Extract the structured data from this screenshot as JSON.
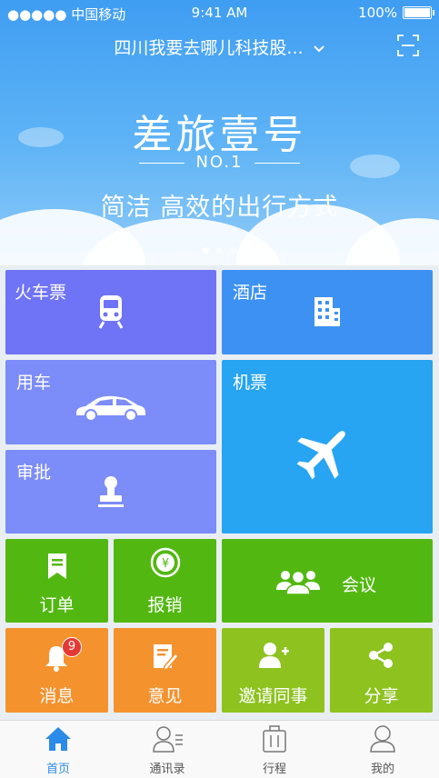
{
  "status_bar": {
    "carrier": "●●●●● 中国移动",
    "time": "9:41 AM",
    "battery": "100%"
  },
  "header": {
    "company": "四川我要去哪儿科技股...",
    "dropdown_icon": "chevron-down-icon",
    "scan_icon": "scan-icon"
  },
  "banner": {
    "title": "差旅壹号",
    "tagline": "NO.1",
    "subtitle": "简洁 高效的出行方式",
    "page_count": 3,
    "active_page": 1
  },
  "tiles": {
    "train": "火车票",
    "hotel": "酒店",
    "car": "用车",
    "flight": "机票",
    "approval": "审批",
    "order": "订单",
    "expense": "报销",
    "meeting": "会议",
    "message": "消息",
    "message_badge": "9",
    "feedback": "意见",
    "invite": "邀请同事",
    "share": "分享"
  },
  "colors": {
    "blue_dark": "#6f73f5",
    "blue": "#3d91f3",
    "sky": "#27a4f2",
    "purple": "#7c8cf8",
    "green": "#52b811",
    "orange": "#f4922e",
    "lime": "#8dc21f"
  },
  "tabbar": [
    {
      "label": "首页",
      "icon": "home-icon",
      "active": true
    },
    {
      "label": "通讯录",
      "icon": "contacts-icon",
      "active": false
    },
    {
      "label": "行程",
      "icon": "luggage-icon",
      "active": false
    },
    {
      "label": "我的",
      "icon": "profile-icon",
      "active": false
    }
  ]
}
